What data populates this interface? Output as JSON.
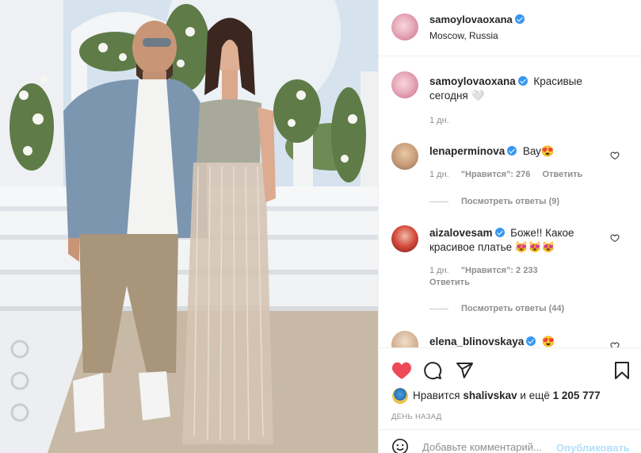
{
  "post": {
    "author": "samoylovaoxana",
    "location": "Moscow, Russia",
    "more_icon": "ellipsis-icon"
  },
  "caption": {
    "author": "samoylovaoxana",
    "text": "Красивые сегодня 🤍",
    "time": "1 дн."
  },
  "comments": [
    {
      "author": "lenaperminova",
      "text": "Вау😍",
      "time": "1 дн.",
      "likes": "\"Нравится\": 276",
      "reply": "Ответить",
      "view_replies": "Посмотреть ответы (9)"
    },
    {
      "author": "aizalovesam",
      "text": "Боже!! Какое красивое платье 😻😻😻",
      "time": "1 дн.",
      "likes": "\"Нравится\": 2 233",
      "reply": "Ответить",
      "view_replies": "Посмотреть ответы (44)"
    },
    {
      "author": "elena_blinovskaya",
      "text": "😍"
    }
  ],
  "likes": {
    "prefix": "Нравится",
    "user": "shalivskav",
    "suffix": "и ещё",
    "count": "1 205 777"
  },
  "date": "ДЕНЬ НАЗАД",
  "comment_box": {
    "placeholder": "Добавьте комментарий...",
    "publish": "Опубликовать"
  },
  "colors": {
    "like_red": "#ed4956",
    "verified_blue": "#3897f0",
    "secondary_text": "#8e8e8e",
    "publish_disabled": "#b2dffc"
  }
}
